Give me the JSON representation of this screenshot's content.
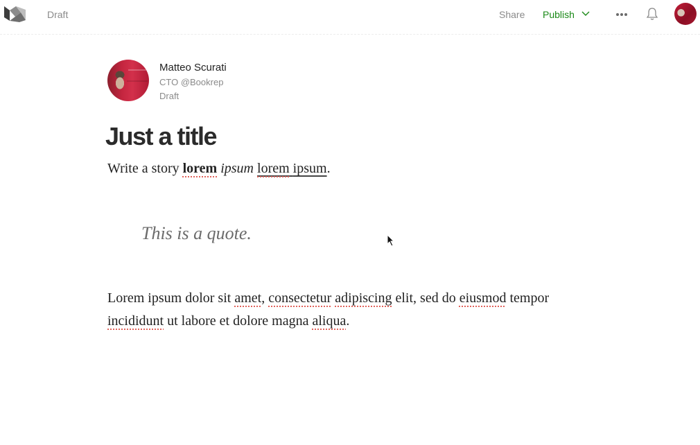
{
  "header": {
    "logo_icon": "medium-logo-icon",
    "status": "Draft",
    "share_label": "Share",
    "publish_label": "Publish",
    "publish_icon": "chevron-down-icon",
    "more_icon": "more-dots-icon",
    "notifications_icon": "bell-icon",
    "avatar": "user-avatar",
    "colors": {
      "accent": "#1a8917",
      "muted": "#8a8a8a"
    }
  },
  "author": {
    "name": "Matteo Scurati",
    "bio": "CTO @Bookrep",
    "status": "Draft"
  },
  "article": {
    "title": "Just a title",
    "story": {
      "w1": "Write a story",
      "bold": "lorem",
      "italic": "ipsum",
      "link_a": "lorem",
      "link_b": "ipsum",
      "end": "."
    },
    "quote": "This is a quote.",
    "paragraph": {
      "p1": "Lorem ipsum dolor sit",
      "s1": "amet",
      "p2": ",",
      "s2": "consectetur",
      "s3": "adipiscing",
      "p3": "elit, sed do",
      "s4": "eiusmod",
      "p4": "tempor",
      "s5": "incididunt",
      "p5": "ut labore et dolore magna",
      "s6": "aliqua",
      "p6": "."
    }
  }
}
